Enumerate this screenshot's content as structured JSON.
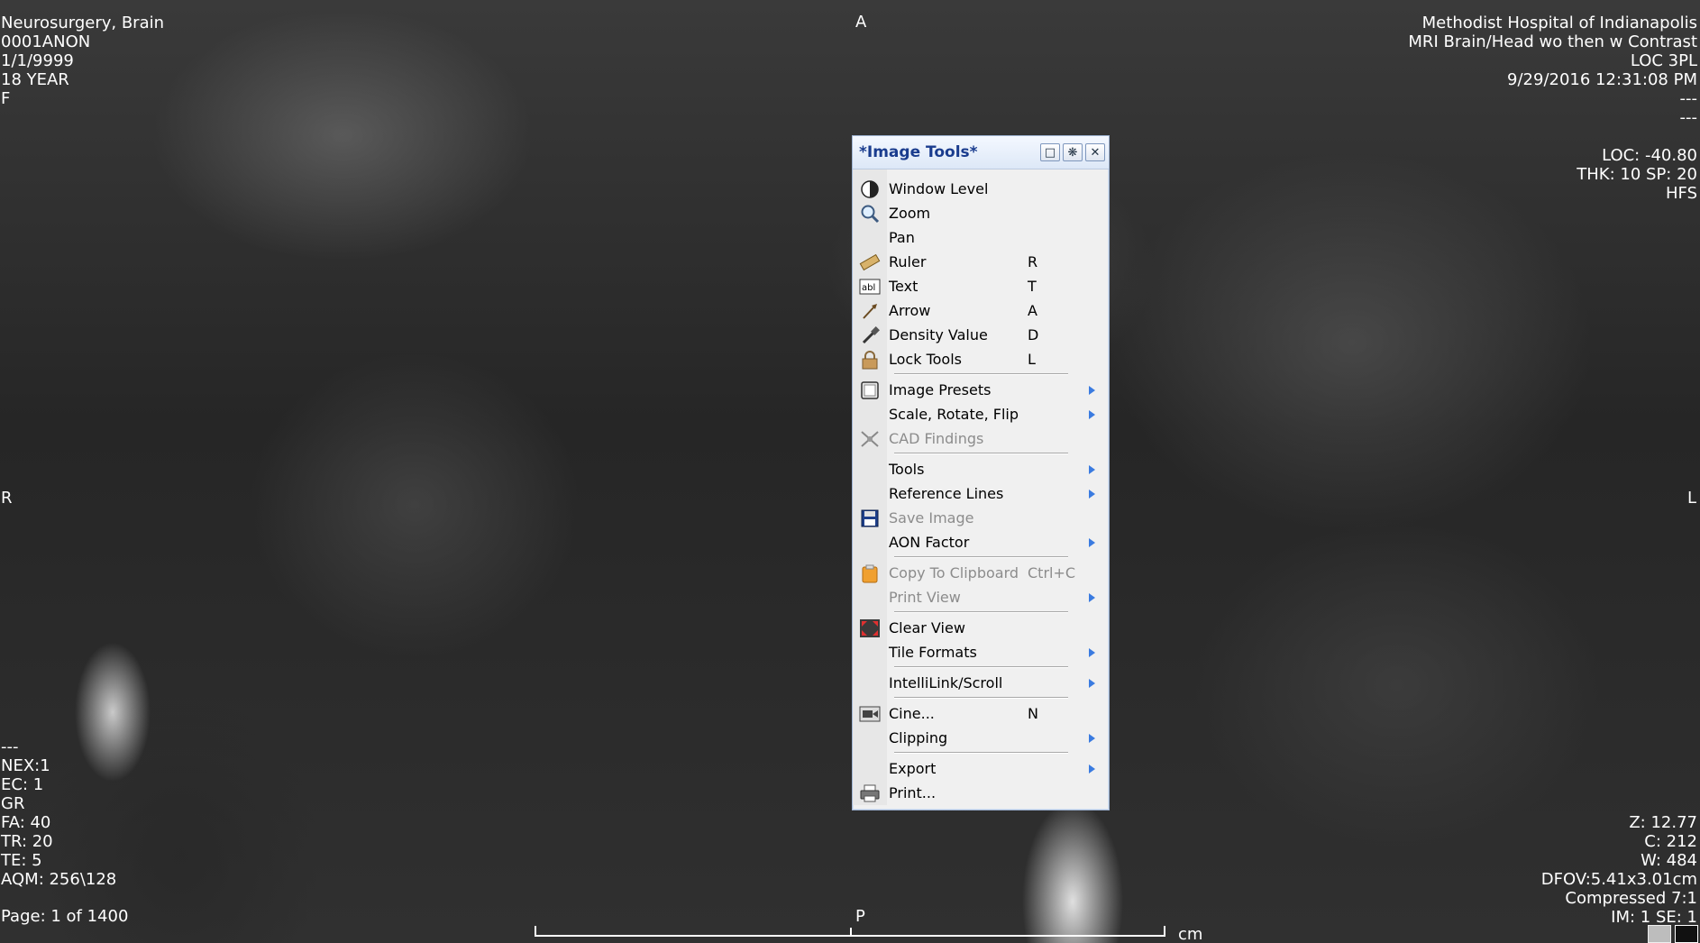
{
  "overlay": {
    "top_left": [
      "Neurosurgery, Brain",
      "0001ANON",
      "1/1/9999",
      "18 YEAR",
      "F"
    ],
    "top_right": [
      "Methodist Hospital of Indianapolis",
      "MRI Brain/Head wo then w Contrast",
      "LOC 3PL",
      "9/29/2016 12:31:08 PM",
      "---",
      "---"
    ],
    "top_right_2": [
      "LOC: -40.80",
      "THK: 10 SP: 20",
      "HFS"
    ],
    "bottom_left": [
      "---",
      "NEX:1",
      "EC: 1",
      "GR",
      "FA: 40",
      "TR: 20",
      "TE: 5",
      "AQM: 256\\128"
    ],
    "bottom_right": [
      "Z: 12.77",
      "C: 212",
      "W: 484",
      "DFOV:5.41x3.01cm",
      "Compressed 7:1",
      "IM: 1 SE: 1"
    ],
    "page": "Page: 1 of 1400",
    "orientation": {
      "top": "A",
      "bottom": "P",
      "left": "R",
      "right": "L"
    },
    "scale_unit": "cm"
  },
  "menu": {
    "title": "*Image Tools*",
    "title_buttons": [
      "restore",
      "pin",
      "close"
    ],
    "items": [
      {
        "icon": "contrast-icon",
        "label": "Window Level",
        "shortcut": "",
        "submenu": false,
        "disabled": false
      },
      {
        "icon": "magnifier-icon",
        "label": "Zoom",
        "shortcut": "",
        "submenu": false,
        "disabled": false
      },
      {
        "icon": "",
        "label": "Pan",
        "shortcut": "",
        "submenu": false,
        "disabled": false
      },
      {
        "icon": "ruler-icon",
        "label": "Ruler",
        "shortcut": "R",
        "submenu": false,
        "disabled": false
      },
      {
        "icon": "text-icon",
        "label": "Text",
        "shortcut": "T",
        "submenu": false,
        "disabled": false
      },
      {
        "icon": "arrow-icon",
        "label": "Arrow",
        "shortcut": "A",
        "submenu": false,
        "disabled": false
      },
      {
        "icon": "dropper-icon",
        "label": "Density Value",
        "shortcut": "D",
        "submenu": false,
        "disabled": false
      },
      {
        "icon": "lock-icon",
        "label": "Lock Tools",
        "shortcut": "L",
        "submenu": false,
        "disabled": false
      },
      {
        "separator": true
      },
      {
        "icon": "presets-icon",
        "label": "Image Presets",
        "shortcut": "",
        "submenu": true,
        "disabled": false
      },
      {
        "icon": "",
        "label": "Scale, Rotate, Flip",
        "shortcut": "",
        "submenu": true,
        "disabled": false
      },
      {
        "icon": "cad-icon",
        "label": "CAD Findings",
        "shortcut": "",
        "submenu": false,
        "disabled": true
      },
      {
        "separator": true
      },
      {
        "icon": "",
        "label": "Tools",
        "shortcut": "",
        "submenu": true,
        "disabled": false
      },
      {
        "icon": "",
        "label": "Reference Lines",
        "shortcut": "",
        "submenu": true,
        "disabled": false
      },
      {
        "icon": "save-icon",
        "label": "Save Image",
        "shortcut": "",
        "submenu": false,
        "disabled": true
      },
      {
        "icon": "",
        "label": "AON Factor",
        "shortcut": "",
        "submenu": true,
        "disabled": false
      },
      {
        "separator": true
      },
      {
        "icon": "clipboard-icon",
        "label": "Copy To Clipboard",
        "shortcut": "Ctrl+C",
        "submenu": false,
        "disabled": true
      },
      {
        "icon": "",
        "label": "Print View",
        "shortcut": "",
        "submenu": true,
        "disabled": true
      },
      {
        "separator": true
      },
      {
        "icon": "clear-view-icon",
        "label": "Clear View",
        "shortcut": "",
        "submenu": false,
        "disabled": false
      },
      {
        "icon": "",
        "label": "Tile Formats",
        "shortcut": "",
        "submenu": true,
        "disabled": false
      },
      {
        "separator": true
      },
      {
        "icon": "",
        "label": "IntelliLink/Scroll",
        "shortcut": "",
        "submenu": true,
        "disabled": false
      },
      {
        "separator": true
      },
      {
        "icon": "cine-icon",
        "label": "Cine...",
        "shortcut": "N",
        "submenu": false,
        "disabled": false
      },
      {
        "icon": "",
        "label": "Clipping",
        "shortcut": "",
        "submenu": true,
        "disabled": false
      },
      {
        "separator": true
      },
      {
        "icon": "",
        "label": "Export",
        "shortcut": "",
        "submenu": true,
        "disabled": false
      },
      {
        "icon": "printer-icon",
        "label": "Print...",
        "shortcut": "",
        "submenu": false,
        "disabled": false
      }
    ]
  },
  "colors": {
    "arrow": "#3a7be0",
    "title": "#1a3c8e",
    "disabled": "#8c8c8c"
  }
}
